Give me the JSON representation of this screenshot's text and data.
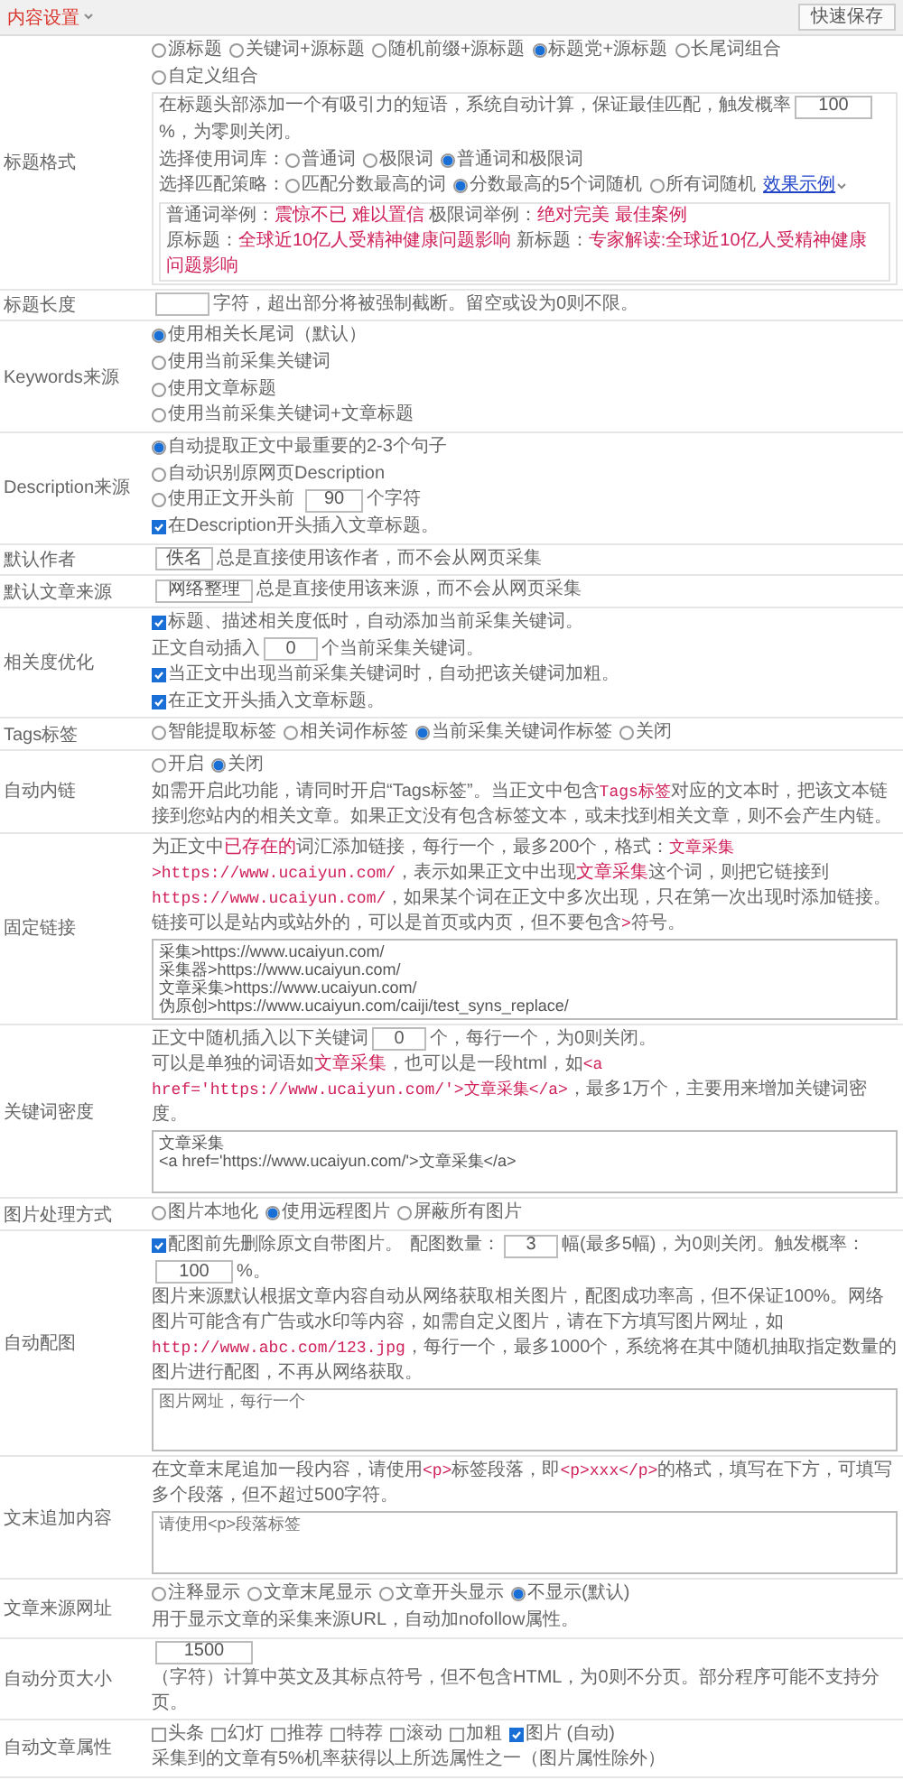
{
  "header": {
    "title": "内容设置",
    "save_button": "快速保存"
  },
  "rows": [
    {
      "label": "标题格式",
      "lines": [
        {
          "kind": "line",
          "items": [
            {
              "kind": "radio",
              "text": "源标题",
              "selected": false
            },
            {
              "kind": "radio",
              "text": "关键词+源标题",
              "selected": false
            },
            {
              "kind": "radio",
              "text": "随机前缀+源标题",
              "selected": false
            },
            {
              "kind": "radio",
              "text": "标题党+源标题",
              "selected": true
            },
            {
              "kind": "radio",
              "text": "长尾词组合",
              "selected": false
            },
            {
              "kind": "radio",
              "text": "自定义组合",
              "selected": false
            }
          ]
        },
        {
          "kind": "panel",
          "lines": [
            {
              "kind": "line",
              "items": [
                {
                  "kind": "text",
                  "text": "在标题头部添加一个有吸引力的短语，系统自动计算，保证最佳匹配，触发概率"
                },
                {
                  "kind": "input",
                  "value": "100"
                },
                {
                  "kind": "text",
                  "text": "%，为零则关闭。"
                }
              ]
            },
            {
              "kind": "line",
              "items": [
                {
                  "kind": "text",
                  "text": "选择使用词库："
                },
                {
                  "kind": "radio",
                  "text": "普通词",
                  "selected": false
                },
                {
                  "kind": "radio",
                  "text": "极限词",
                  "selected": false
                },
                {
                  "kind": "radio",
                  "text": "普通词和极限词",
                  "selected": true
                }
              ]
            },
            {
              "kind": "line",
              "items": [
                {
                  "kind": "text",
                  "text": "选择匹配策略："
                },
                {
                  "kind": "radio",
                  "text": "匹配分数最高的词",
                  "selected": false
                },
                {
                  "kind": "radio",
                  "text": "分数最高的5个词随机",
                  "selected": true
                },
                {
                  "kind": "radio",
                  "text": "所有词随机",
                  "selected": false
                },
                {
                  "kind": "link",
                  "text": "效果示例"
                }
              ]
            },
            {
              "kind": "panel",
              "lines": [
                {
                  "kind": "para",
                  "items": [
                    {
                      "kind": "text",
                      "text": "普通词举例："
                    },
                    {
                      "kind": "red",
                      "text": "震惊不已 难以置信"
                    },
                    {
                      "kind": "text",
                      "text": " 极限词举例："
                    },
                    {
                      "kind": "red",
                      "text": "绝对完美 最佳案例"
                    }
                  ]
                },
                {
                  "kind": "para",
                  "items": [
                    {
                      "kind": "text",
                      "text": "原标题："
                    },
                    {
                      "kind": "red",
                      "text": "全球近10亿人受精神健康问题影响"
                    },
                    {
                      "kind": "text",
                      "text": " 新标题："
                    },
                    {
                      "kind": "red",
                      "text": "专家解读:全球近10亿人受精神健康问题影响"
                    }
                  ]
                }
              ]
            }
          ]
        }
      ]
    },
    {
      "label": "标题长度",
      "lines": [
        {
          "kind": "line",
          "items": [
            {
              "kind": "input"
            },
            {
              "kind": "text",
              "text": "字符，超出部分将被强制截断。留空或设为0则不限。"
            }
          ]
        }
      ]
    },
    {
      "label": "Keywords来源",
      "lines": [
        {
          "kind": "line",
          "items": [
            {
              "kind": "radio",
              "text": "使用相关长尾词（默认）",
              "selected": true
            }
          ]
        },
        {
          "kind": "line",
          "items": [
            {
              "kind": "radio",
              "text": "使用当前采集关键词",
              "selected": false
            }
          ]
        },
        {
          "kind": "line",
          "items": [
            {
              "kind": "radio",
              "text": "使用文章标题",
              "selected": false
            }
          ]
        },
        {
          "kind": "line",
          "items": [
            {
              "kind": "radio",
              "text": "使用当前采集关键词+文章标题",
              "selected": false
            }
          ]
        }
      ]
    },
    {
      "label": "Description来源",
      "lines": [
        {
          "kind": "line",
          "items": [
            {
              "kind": "radio",
              "text": "自动提取正文中最重要的2-3个句子",
              "selected": true
            }
          ]
        },
        {
          "kind": "line",
          "items": [
            {
              "kind": "radio",
              "text": "自动识别原网页Description",
              "selected": false
            }
          ]
        },
        {
          "kind": "line",
          "items": [
            {
              "kind": "radio",
              "text": "使用正文开头前",
              "selected": false
            },
            {
              "kind": "input",
              "value": "90"
            },
            {
              "kind": "text",
              "text": "个字符"
            }
          ]
        },
        {
          "kind": "line",
          "items": [
            {
              "kind": "checkbox",
              "text": "在Description开头插入文章标题。",
              "checked": true
            }
          ]
        }
      ]
    },
    {
      "label": "默认作者",
      "lines": [
        {
          "kind": "line",
          "items": [
            {
              "kind": "input",
              "value": "佚名"
            },
            {
              "kind": "text",
              "text": "总是直接使用该作者，而不会从网页采集"
            }
          ]
        }
      ]
    },
    {
      "label": "默认文章来源",
      "lines": [
        {
          "kind": "line",
          "items": [
            {
              "kind": "input",
              "value": "网络整理"
            },
            {
              "kind": "text",
              "text": "总是直接使用该来源，而不会从网页采集"
            }
          ]
        }
      ]
    },
    {
      "label": "相关度优化",
      "lines": [
        {
          "kind": "line",
          "items": [
            {
              "kind": "checkbox",
              "text": "标题、描述相关度低时，自动添加当前采集关键词。",
              "checked": true
            }
          ]
        },
        {
          "kind": "line",
          "items": [
            {
              "kind": "text",
              "text": "正文自动插入"
            },
            {
              "kind": "input",
              "value": "0"
            },
            {
              "kind": "text",
              "text": "个当前采集关键词。"
            }
          ]
        },
        {
          "kind": "line",
          "items": [
            {
              "kind": "checkbox",
              "text": "当正文中出现当前采集关键词时，自动把该关键词加粗。",
              "checked": true
            }
          ]
        },
        {
          "kind": "line",
          "items": [
            {
              "kind": "checkbox",
              "text": "在正文开头插入文章标题。",
              "checked": true
            }
          ]
        }
      ]
    },
    {
      "label": "Tags标签",
      "lines": [
        {
          "kind": "line",
          "items": [
            {
              "kind": "radio",
              "text": "智能提取标签",
              "selected": false
            },
            {
              "kind": "radio",
              "text": "相关词作标签",
              "selected": false
            },
            {
              "kind": "radio",
              "text": "当前采集关键词作标签",
              "selected": true
            },
            {
              "kind": "radio",
              "text": "关闭",
              "selected": false
            }
          ]
        }
      ]
    },
    {
      "label": "自动内链",
      "lines": [
        {
          "kind": "line",
          "items": [
            {
              "kind": "radio",
              "text": "开启",
              "selected": false
            },
            {
              "kind": "radio",
              "text": "关闭",
              "selected": true
            }
          ]
        },
        {
          "kind": "para",
          "items": [
            {
              "kind": "text",
              "text": "如需开启此功能，请同时开启“Tags标签”。当正文中包含"
            },
            {
              "kind": "code",
              "text": "Tags标签"
            },
            {
              "kind": "text",
              "text": "对应的文本时，把该文本链接到您站内的相关文章。如果正文没有包含标签文本，或未找到相关文章，则不会产生内链。"
            }
          ]
        }
      ]
    },
    {
      "label": "固定链接",
      "lines": [
        {
          "kind": "para",
          "items": [
            {
              "kind": "text",
              "text": "为正文中"
            },
            {
              "kind": "red",
              "text": "已存在的"
            },
            {
              "kind": "text",
              "text": "词汇添加链接，每行一个，最多200个，格式："
            },
            {
              "kind": "code",
              "text": "文章采集>https://www.ucaiyun.com/"
            },
            {
              "kind": "text",
              "text": "，表示如果正文中出现"
            },
            {
              "kind": "red",
              "text": "文章采集"
            },
            {
              "kind": "text",
              "text": "这个词，则把它链接到"
            },
            {
              "kind": "code",
              "text": "https://www.ucaiyun.com/"
            },
            {
              "kind": "text",
              "text": "，如果某个词在正文中多次出现，只在第一次出现时添加链接。链接可以是站内或站外的，可以是首页或内页，但不要包含"
            },
            {
              "kind": "code",
              "text": ">"
            },
            {
              "kind": "text",
              "text": "符号。"
            }
          ]
        },
        {
          "kind": "textarea",
          "value": "采集>https://www.ucaiyun.com/\n采集器>https://www.ucaiyun.com/\n文章采集>https://www.ucaiyun.com/\n伪原创>https://www.ucaiyun.com/caiji/test_syns_replace/"
        }
      ]
    },
    {
      "label": "关键词密度",
      "lines": [
        {
          "kind": "line",
          "items": [
            {
              "kind": "text",
              "text": "正文中随机插入以下关键词"
            },
            {
              "kind": "input",
              "value": "0"
            },
            {
              "kind": "text",
              "text": "个，每行一个，为0则关闭。"
            }
          ]
        },
        {
          "kind": "para",
          "items": [
            {
              "kind": "text",
              "text": "可以是单独的词语如"
            },
            {
              "kind": "red",
              "text": "文章采集"
            },
            {
              "kind": "text",
              "text": "，也可以是一段html，如"
            },
            {
              "kind": "code",
              "text": "<a href='https://www.ucaiyun.com/'>文章采集</a>"
            },
            {
              "kind": "text",
              "text": "，最多1万个，主要用来增加关键词密度。"
            }
          ]
        },
        {
          "kind": "textarea",
          "value": "文章采集\n<a href='https://www.ucaiyun.com/'>文章采集</a>"
        }
      ]
    },
    {
      "label": "图片处理方式",
      "lines": [
        {
          "kind": "line",
          "items": [
            {
              "kind": "radio",
              "text": "图片本地化",
              "selected": false
            },
            {
              "kind": "radio",
              "text": "使用远程图片",
              "selected": true
            },
            {
              "kind": "radio",
              "text": "屏蔽所有图片",
              "selected": false
            }
          ]
        }
      ]
    },
    {
      "label": "自动配图",
      "lines": [
        {
          "kind": "line",
          "items": [
            {
              "kind": "checkbox",
              "text": "配图前先删除原文自带图片。",
              "checked": true
            },
            {
              "kind": "text",
              "text": "配图数量："
            },
            {
              "kind": "input",
              "value": "3"
            },
            {
              "kind": "text",
              "text": "幅(最多5幅)，为0则关闭。"
            },
            {
              "kind": "text",
              "text": "触发概率："
            },
            {
              "kind": "input",
              "value": "100"
            },
            {
              "kind": "text",
              "text": "%。"
            }
          ]
        },
        {
          "kind": "para",
          "items": [
            {
              "kind": "text",
              "text": "图片来源默认根据文章内容自动从网络获取相关图片，配图成功率高，但不保证100%。网络图片可能含有广告或水印等内容，如需自定义图片，请在下方填写图片网址，如"
            },
            {
              "kind": "code",
              "text": "http://www.abc.com/123.jpg"
            },
            {
              "kind": "text",
              "text": "，每行一个，最多1000个，系统将在其中随机抽取指定数量的图片进行配图，不再从网络获取。"
            }
          ]
        },
        {
          "kind": "textarea",
          "placeholder": "图片网址，每行一个"
        }
      ]
    },
    {
      "label": "文末追加内容",
      "lines": [
        {
          "kind": "para",
          "items": [
            {
              "kind": "text",
              "text": "在文章末尾追加一段内容，请使用"
            },
            {
              "kind": "code",
              "text": "<p>"
            },
            {
              "kind": "text",
              "text": "标签段落，即"
            },
            {
              "kind": "code",
              "text": "<p>xxx</p>"
            },
            {
              "kind": "text",
              "text": "的格式，填写在下方，可填写多个段落，但不超过500字符。"
            }
          ]
        },
        {
          "kind": "textarea",
          "placeholder": "请使用<p>段落标签"
        }
      ]
    },
    {
      "label": "文章来源网址",
      "lines": [
        {
          "kind": "line",
          "items": [
            {
              "kind": "radio",
              "text": "注释显示",
              "selected": false
            },
            {
              "kind": "radio",
              "text": "文章末尾显示",
              "selected": false
            },
            {
              "kind": "radio",
              "text": "文章开头显示",
              "selected": false
            },
            {
              "kind": "radio",
              "text": "不显示(默认)",
              "selected": true
            }
          ]
        },
        {
          "kind": "line",
          "items": [
            {
              "kind": "text",
              "text": "用于显示文章的采集来源URL，自动加nofollow属性。"
            }
          ]
        }
      ]
    },
    {
      "label": "自动分页大小",
      "lines": [
        {
          "kind": "line",
          "items": [
            {
              "kind": "input",
              "value": "1500"
            },
            {
              "kind": "text",
              "text": "（字符）计算中英文及其标点符号，但不包含HTML，为0则不分页。部分程序可能不支持分页。"
            }
          ]
        }
      ]
    },
    {
      "label": "自动文章属性",
      "lines": [
        {
          "kind": "line",
          "items": [
            {
              "kind": "checkbox",
              "text": "头条",
              "checked": false
            },
            {
              "kind": "checkbox",
              "text": "幻灯",
              "checked": false
            },
            {
              "kind": "checkbox",
              "text": "推荐",
              "checked": false
            },
            {
              "kind": "checkbox",
              "text": "特荐",
              "checked": false
            },
            {
              "kind": "checkbox",
              "text": "滚动",
              "checked": false
            },
            {
              "kind": "checkbox",
              "text": "加粗",
              "checked": false
            },
            {
              "kind": "checkbox",
              "text": "图片 (自动)",
              "checked": true
            }
          ]
        },
        {
          "kind": "line",
          "items": [
            {
              "kind": "text",
              "text": "采集到的文章有5%机率获得以上所选属性之一（图片属性除外）"
            }
          ]
        }
      ]
    }
  ]
}
